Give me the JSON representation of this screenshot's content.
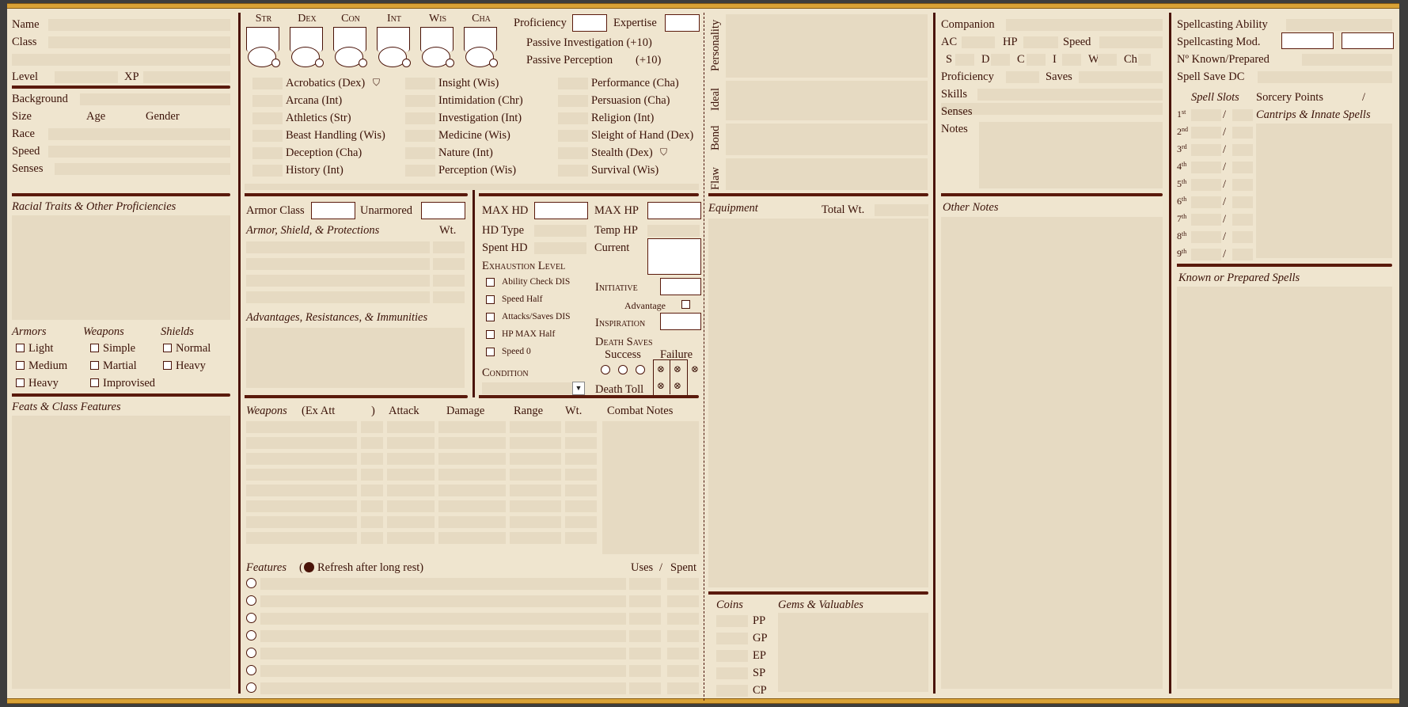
{
  "col1": {
    "name": "Name",
    "class": "Class",
    "level": "Level",
    "xp": "XP",
    "background": "Background",
    "size": "Size",
    "age": "Age",
    "gender": "Gender",
    "race": "Race",
    "speed": "Speed",
    "senses": "Senses",
    "racial_traits": "Racial Traits & Other Proficiencies",
    "armors": "Armors",
    "weapons": "Weapons",
    "shields": "Shields",
    "armor_items": [
      "Light",
      "Medium",
      "Heavy"
    ],
    "weapon_items": [
      "Simple",
      "Martial",
      "Improvised"
    ],
    "shield_items": [
      "Normal",
      "Heavy"
    ],
    "feats": "Feats & Class Features"
  },
  "abilities": [
    "Str",
    "Dex",
    "Con",
    "Int",
    "Wis",
    "Cha"
  ],
  "prof": {
    "proficiency": "Proficiency",
    "expertise": "Expertise",
    "passive_investigation": "Passive Investigation (+10)",
    "passive_perception": "Passive Perception",
    "passive_perception_val": "(+10)"
  },
  "skills": {
    "col1": [
      "Acrobatics (Dex)",
      "Arcana (Int)",
      "Athletics (Str)",
      "Beast Handling (Wis)",
      "Deception (Cha)",
      "History (Int)"
    ],
    "col2": [
      "Insight (Wis)",
      "Intimidation (Chr)",
      "Investigation (Int)",
      "Medicine (Wis)",
      "Nature (Int)",
      "Perception (Wis)"
    ],
    "col3": [
      "Performance (Cha)",
      "Persuasion (Cha)",
      "Religion (Int)",
      "Sleight of Hand (Dex)",
      "Stealth (Dex)",
      "Survival (Wis)"
    ]
  },
  "armor": {
    "armor_class": "Armor Class",
    "unarmored": "Unarmored",
    "protections": "Armor, Shield, & Protections",
    "wt": "Wt.",
    "advantages": "Advantages, Resistances, & Immunities"
  },
  "hp": {
    "max_hd": "MAX HD",
    "max_hp": "MAX HP",
    "hd_type": "HD Type",
    "temp_hp": "Temp HP",
    "spent_hd": "Spent HD",
    "current": "Current",
    "exhaustion": "Exhaustion Level",
    "exhaustion_items": [
      "Ability Check DIS",
      "Speed Half",
      "Attacks/Saves DIS",
      "HP MAX Half",
      "Speed 0"
    ],
    "initiative": "Initiative",
    "advantage": "Advantage",
    "inspiration": "Inspiration",
    "death_saves": "Death Saves",
    "success": "Success",
    "failure": "Failure",
    "condition": "Condition",
    "death_toll": "Death Toll"
  },
  "weapons": {
    "title": "Weapons",
    "ex_att": "(Ex Att",
    "paren": ")",
    "attack": "Attack",
    "damage": "Damage",
    "range": "Range",
    "wt": "Wt.",
    "combat_notes": "Combat Notes"
  },
  "features": {
    "title": "Features",
    "refresh_open": "(",
    "refresh": "Refresh after long rest)",
    "uses": "Uses",
    "slash": "/",
    "spent": "Spent"
  },
  "vertical": [
    "Personality",
    "Ideal",
    "Bond",
    "Flaw"
  ],
  "equipment": {
    "title": "Equipment",
    "total_wt": "Total Wt.",
    "coins": "Coins",
    "gems": "Gems & Valuables",
    "coin_list": [
      "PP",
      "GP",
      "EP",
      "SP",
      "CP"
    ]
  },
  "companion": {
    "companion": "Companion",
    "ac": "AC",
    "hp": "HP",
    "speed": "Speed",
    "stats": [
      "S",
      "D",
      "C",
      "I",
      "W",
      "Ch"
    ],
    "proficiency": "Proficiency",
    "saves": "Saves",
    "skills": "Skills",
    "senses": "Senses",
    "notes": "Notes",
    "other_notes": "Other Notes"
  },
  "spells": {
    "ability": "Spellcasting Ability",
    "mod": "Spellcasting Mod.",
    "known": "Nº Known/Prepared",
    "save_dc": "Spell Save DC",
    "slots": "Spell Slots",
    "sorcery": "Sorcery Points",
    "slash": "/",
    "cantrips": "Cantrips & Innate Spells",
    "known_prepared": "Known or Prepared Spells",
    "levels": [
      "1",
      "2",
      "3",
      "4",
      "5",
      "6",
      "7",
      "8",
      "9"
    ],
    "suffixes": [
      "st",
      "nd",
      "rd",
      "th",
      "th",
      "th",
      "th",
      "th",
      "th"
    ]
  }
}
